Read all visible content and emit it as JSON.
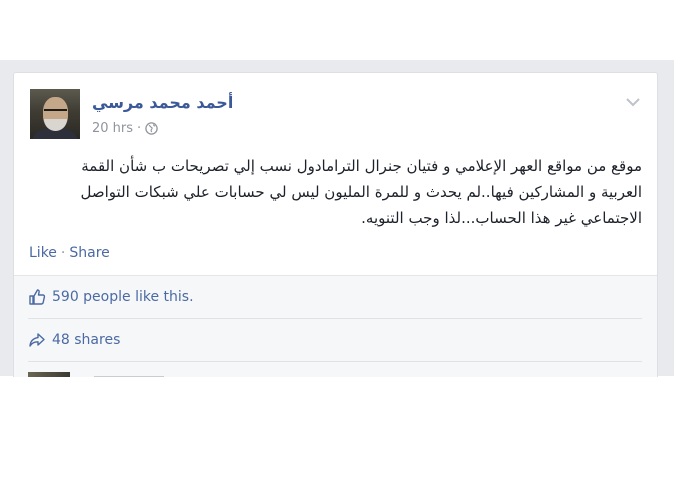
{
  "post": {
    "author": "أحمد محمد مرسي",
    "time": "20 hrs",
    "meta_separator": "·",
    "privacy_icon": "globe-icon",
    "options_icon": "chevron-down-icon",
    "body": "موقع من مواقع العهر الإعلامي و فتيان جنرال الترامادول نسب إلي تصريحات ب شأن القمة العربية و المشاركين فيها..لم يحدث و للمرة المليون ليس لي حسابات علي شبكات التواصل الاجتماعي غير هذا الحساب...لذا وجب التنويه.",
    "actions": {
      "like": "Like",
      "separator": "·",
      "share": "Share"
    },
    "stats": {
      "likes": "590 people like this.",
      "likes_icon": "thumbs-up-icon",
      "shares": "48 shares",
      "shares_icon": "share-arrow-icon"
    }
  },
  "colors": {
    "link": "#3b5998",
    "meta": "#90949c",
    "text": "#1d2129",
    "background": "#e9eaed",
    "stats_background": "#f6f7f9"
  }
}
